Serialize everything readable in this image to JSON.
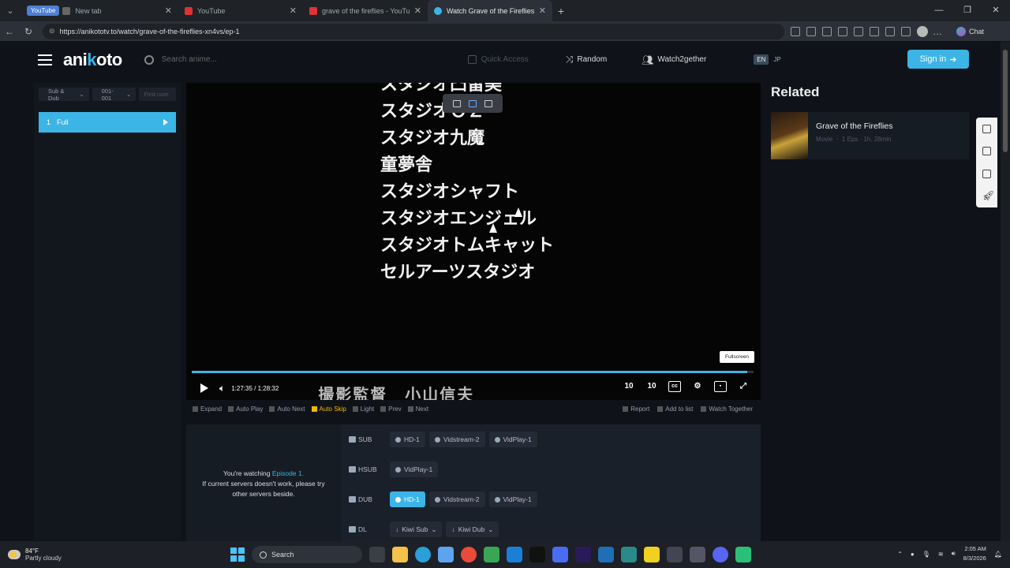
{
  "browser": {
    "tabs": [
      {
        "group": "YouTube",
        "title": "",
        "active": false,
        "color": "#4d7fd6"
      },
      {
        "title": "New tab",
        "active": false,
        "color": "#666666"
      },
      {
        "title": "YouTube",
        "active": false,
        "color": "#d33333"
      },
      {
        "title": "grave of the fireflies - YouTube",
        "active": false,
        "color": "#d33333"
      },
      {
        "title": "Watch Grave of the Fireflies Episode",
        "active": true,
        "color": "#3cb4e6"
      }
    ],
    "url": "https://anikototv.to/watch/grave-of-the-fireflies-xn4vs/ep-1",
    "chat_label": "Chat"
  },
  "header": {
    "logo_a": "ani",
    "logo_b": "k",
    "logo_c": "oto",
    "search_placeholder": "Search anime...",
    "quick_access": "Quick Access",
    "random": "Random",
    "watch2gether": "Watch2gether",
    "lang_en": "EN",
    "lang_jp": "JP",
    "signin": "Sign in"
  },
  "episodes": {
    "filter_type": "Sub & Dub",
    "filter_range": "001-001",
    "find_placeholder": "Find num",
    "items": [
      {
        "num": "1",
        "name": "Full"
      }
    ]
  },
  "player": {
    "credits": [
      "スタジオ凸留美",
      "スタジオＯＺ",
      "スタジオ九魔",
      "童夢舎",
      "スタジオシャフト",
      "スタジオエンジェル",
      "スタジオトムキャット",
      "セルアーツスタジオ"
    ],
    "subtitle_ghost": "撮影監督　小山信夫",
    "current_time": "1:27:35",
    "time_sep": "/",
    "duration": "1:28:32",
    "progress": 0.989,
    "fullscreen_tooltip": "Fullscreen",
    "skip_back": "10",
    "skip_fwd": "10"
  },
  "options": {
    "expand": "Expand",
    "autoplay": "Auto Play",
    "autonext": "Auto Next",
    "autoskip": "Auto Skip",
    "light": "Light",
    "prev": "Prev",
    "next": "Next",
    "report": "Report",
    "add_to_list": "Add to list",
    "watch_together": "Watch Together"
  },
  "servers": {
    "watching_prefix": "You're watching",
    "watching_ep": "Episode 1.",
    "watching_note": "If current servers doesn't work, please try other servers beside.",
    "rows": [
      {
        "label": "SUB",
        "buttons": [
          {
            "name": "HD-1",
            "active": false
          },
          {
            "name": "Vidstream-2",
            "active": false
          },
          {
            "name": "VidPlay-1",
            "active": false
          }
        ]
      },
      {
        "label": "HSUB",
        "buttons": [
          {
            "name": "VidPlay-1",
            "active": false
          }
        ]
      },
      {
        "label": "DUB",
        "buttons": [
          {
            "name": "HD-1",
            "active": true
          },
          {
            "name": "Vidstream-2",
            "active": false
          },
          {
            "name": "VidPlay-1",
            "active": false
          }
        ]
      },
      {
        "label": "DL",
        "buttons": [
          {
            "name": "Kiwi Sub",
            "active": false
          },
          {
            "name": "Kiwi Dub",
            "active": false
          }
        ]
      }
    ]
  },
  "related": {
    "title": "Related",
    "items": [
      {
        "name": "Grave of the Fireflies",
        "type": "Movie",
        "eps": "1 Eps",
        "dur": "1h. 28min"
      }
    ]
  },
  "taskbar": {
    "temp": "84°F",
    "weather": "Partly cloudy",
    "search": "Search",
    "time": "2:05 AM",
    "date": "8/3/2026"
  },
  "colors": {
    "accent": "#3cb4e6",
    "autoskip": "#f2b800"
  }
}
